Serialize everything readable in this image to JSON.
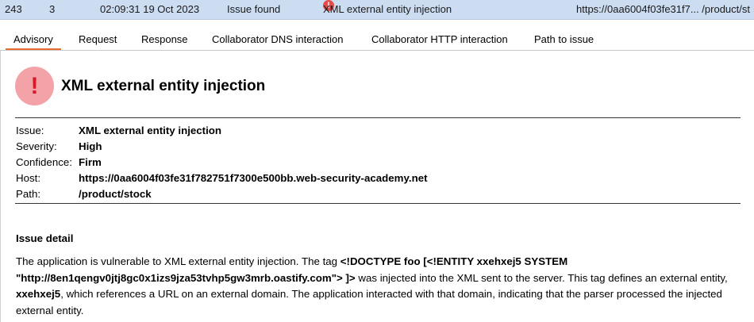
{
  "issue_row": {
    "id": "243",
    "task": "3",
    "time": "02:09:31 19 Oct 2023",
    "action": "Issue found",
    "issue": "XML external entity injection",
    "url": "https://0aa6004f03fe31f7...   /product/st"
  },
  "tabs": [
    "Advisory",
    "Request",
    "Response",
    "Collaborator DNS interaction",
    "Collaborator HTTP interaction",
    "Path to issue"
  ],
  "advisory": {
    "title": "XML external entity injection",
    "properties": [
      {
        "key": "Issue:",
        "value": "XML external entity injection"
      },
      {
        "key": "Severity:",
        "value": "High"
      },
      {
        "key": "Confidence:",
        "value": "Firm"
      },
      {
        "key": "Host:",
        "value": "https://0aa6004f03fe31f782751f7300e500bb.web-security-academy.net"
      },
      {
        "key": "Path:",
        "value": "/product/stock"
      }
    ],
    "detail_heading": "Issue detail",
    "detail": {
      "p1": "The application is vulnerable to XML external entity injection. The tag ",
      "tag": "<!DOCTYPE foo [<!ENTITY xxehxej5 SYSTEM \"http://8en1qengv0jtj8gc0x1izs9jza53tvhp5gw3mrb.oastify.com\"> ]>",
      "p2": " was injected into the XML sent to the server. This tag defines an external entity, ",
      "entity": "xxehxej5",
      "p3": ", which references a URL on an external domain. The application interacted with that domain, indicating that the parser processed the injected external entity."
    }
  },
  "colors": {
    "row_selected": "#ccdcf1",
    "alert_red": "#e54b4b",
    "alert_pink": "#f3a3a8",
    "active_tab": "#e8692e"
  },
  "icons": [
    "alert-circle-icon"
  ]
}
